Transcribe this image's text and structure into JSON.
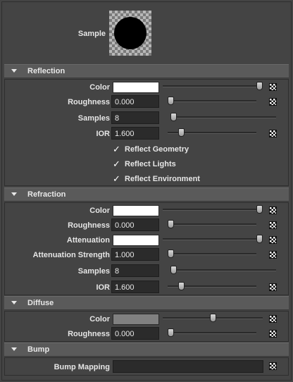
{
  "sample": {
    "label": "Sample"
  },
  "reflection": {
    "title": "Reflection",
    "color_label": "Color",
    "color_value": "#ffffff",
    "color_level": 1.0,
    "roughness_label": "Roughness",
    "roughness_value": "0.000",
    "roughness_level": 0.0,
    "samples_label": "Samples",
    "samples_value": "8",
    "samples_level": 0.0,
    "ior_label": "IOR",
    "ior_value": "1.600",
    "ior_level": 0.13,
    "reflect_geometry": "Reflect Geometry",
    "reflect_lights": "Reflect Lights",
    "reflect_environment": "Reflect Environment"
  },
  "refraction": {
    "title": "Refraction",
    "color_label": "Color",
    "color_value": "#ffffff",
    "color_level": 1.0,
    "roughness_label": "Roughness",
    "roughness_value": "0.000",
    "roughness_level": 0.0,
    "attenuation_label": "Attenuation",
    "attenuation_value": "#ffffff",
    "attenuation_level": 1.0,
    "attenuation_strength_label": "Attenuation Strength",
    "attenuation_strength_value": "1.000",
    "attenuation_strength_level": 0.0,
    "samples_label": "Samples",
    "samples_value": "8",
    "samples_level": 0.0,
    "ior_label": "IOR",
    "ior_value": "1.600",
    "ior_level": 0.13
  },
  "diffuse": {
    "title": "Diffuse",
    "color_label": "Color",
    "color_value": "#808080",
    "color_level": 0.5,
    "roughness_label": "Roughness",
    "roughness_value": "0.000",
    "roughness_level": 0.0
  },
  "bump": {
    "title": "Bump",
    "bump_mapping_label": "Bump Mapping",
    "bump_mapping_value": ""
  },
  "colors": {
    "panel": "#444444",
    "header": "#5a5a5a",
    "field": "#2b2b2b"
  }
}
